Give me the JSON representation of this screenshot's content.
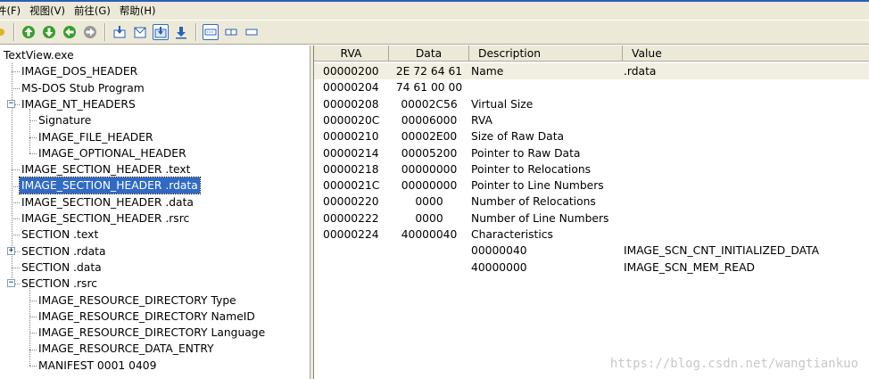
{
  "menu": [
    "件(F)",
    "视图(V)",
    "前往(G)",
    "帮助(H)"
  ],
  "tree": {
    "root": "TextView.exe",
    "items": [
      {
        "label": "IMAGE_DOS_HEADER"
      },
      {
        "label": "MS-DOS Stub Program"
      },
      {
        "label": "IMAGE_NT_HEADERS",
        "expanded": true
      },
      {
        "label": "Signature"
      },
      {
        "label": "IMAGE_FILE_HEADER"
      },
      {
        "label": "IMAGE_OPTIONAL_HEADER"
      },
      {
        "label": "IMAGE_SECTION_HEADER .text"
      },
      {
        "label": "IMAGE_SECTION_HEADER .rdata",
        "selected": true
      },
      {
        "label": "IMAGE_SECTION_HEADER .data"
      },
      {
        "label": "IMAGE_SECTION_HEADER .rsrc"
      },
      {
        "label": "SECTION .text"
      },
      {
        "label": "SECTION .rdata",
        "collapsed": true
      },
      {
        "label": "SECTION .data"
      },
      {
        "label": "SECTION .rsrc",
        "expanded": true
      },
      {
        "label": "IMAGE_RESOURCE_DIRECTORY Type"
      },
      {
        "label": "IMAGE_RESOURCE_DIRECTORY NameID"
      },
      {
        "label": "IMAGE_RESOURCE_DIRECTORY Language"
      },
      {
        "label": "IMAGE_RESOURCE_DATA_ENTRY"
      },
      {
        "label": "MANIFEST  0001  0409"
      }
    ]
  },
  "list": {
    "columns": [
      "RVA",
      "Data",
      "Description",
      "Value"
    ],
    "rows": [
      {
        "rva": "00000200",
        "data": "2E  72  64  61",
        "desc": "Name",
        "value": ".rdata"
      },
      {
        "rva": "00000204",
        "data": "74  61  00  00",
        "desc": "",
        "value": ""
      },
      {
        "rva": "00000208",
        "data": "00002C56",
        "desc": "Virtual Size",
        "value": ""
      },
      {
        "rva": "0000020C",
        "data": "00006000",
        "desc": "RVA",
        "value": ""
      },
      {
        "rva": "00000210",
        "data": "00002E00",
        "desc": "Size of Raw Data",
        "value": ""
      },
      {
        "rva": "00000214",
        "data": "00005200",
        "desc": "Pointer to Raw Data",
        "value": ""
      },
      {
        "rva": "00000218",
        "data": "00000000",
        "desc": "Pointer to Relocations",
        "value": ""
      },
      {
        "rva": "0000021C",
        "data": "00000000",
        "desc": "Pointer to Line Numbers",
        "value": ""
      },
      {
        "rva": "00000220",
        "data": "0000",
        "desc": "Number of Relocations",
        "value": ""
      },
      {
        "rva": "00000222",
        "data": "0000",
        "desc": "Number of Line Numbers",
        "value": ""
      },
      {
        "rva": "00000224",
        "data": "40000040",
        "desc": "Characteristics",
        "value": ""
      },
      {
        "rva": "",
        "data": "",
        "desc": "00000040",
        "value": "IMAGE_SCN_CNT_INITIALIZED_DATA"
      },
      {
        "rva": "",
        "data": "",
        "desc": "40000000",
        "value": "IMAGE_SCN_MEM_READ"
      }
    ]
  },
  "watermark": "https://blog.csdn.net/wangtiankuo",
  "colors": {
    "selection": "#316ac5",
    "chrome": "#ece9d8",
    "titlebar": "#2a5fb8"
  }
}
